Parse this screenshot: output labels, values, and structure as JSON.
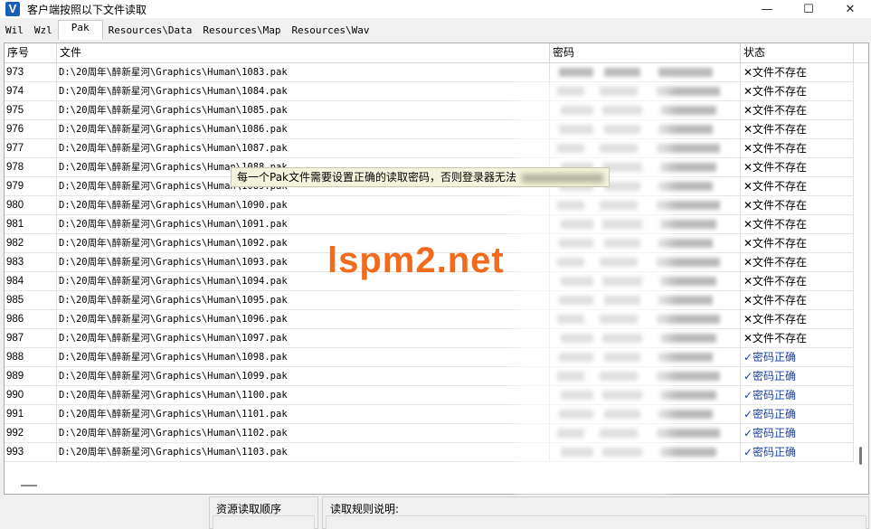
{
  "window": {
    "icon_letter": "V",
    "title": "客户端按照以下文件读取",
    "minimize": "—",
    "maximize": "☐",
    "close": "✕"
  },
  "tabs": [
    "Wil",
    "Wzl",
    "Pak",
    "Resources\\Data",
    "Resources\\Map",
    "Resources\\Wav"
  ],
  "active_tab": "Pak",
  "table": {
    "headers": {
      "index": "序号",
      "file": "文件",
      "password": "密码",
      "status": "状态"
    },
    "rows": [
      {
        "index": "973",
        "file": "D:\\20周年\\醉新星河\\Graphics\\Human\\1083.pak",
        "status": "✕文件不存在",
        "ok": false
      },
      {
        "index": "974",
        "file": "D:\\20周年\\醉新星河\\Graphics\\Human\\1084.pak",
        "status": "✕文件不存在",
        "ok": false
      },
      {
        "index": "975",
        "file": "D:\\20周年\\醉新星河\\Graphics\\Human\\1085.pak",
        "status": "✕文件不存在",
        "ok": false
      },
      {
        "index": "976",
        "file": "D:\\20周年\\醉新星河\\Graphics\\Human\\1086.pak",
        "status": "✕文件不存在",
        "ok": false
      },
      {
        "index": "977",
        "file": "D:\\20周年\\醉新星河\\Graphics\\Human\\1087.pak",
        "status": "✕文件不存在",
        "ok": false
      },
      {
        "index": "978",
        "file": "D:\\20周年\\醉新星河\\Graphics\\Human\\1088.pak",
        "status": "✕文件不存在",
        "ok": false
      },
      {
        "index": "979",
        "file": "D:\\20周年\\醉新星河\\Graphics\\Human\\1089.pak",
        "status": "✕文件不存在",
        "ok": false
      },
      {
        "index": "980",
        "file": "D:\\20周年\\醉新星河\\Graphics\\Human\\1090.pak",
        "status": "✕文件不存在",
        "ok": false
      },
      {
        "index": "981",
        "file": "D:\\20周年\\醉新星河\\Graphics\\Human\\1091.pak",
        "status": "✕文件不存在",
        "ok": false
      },
      {
        "index": "982",
        "file": "D:\\20周年\\醉新星河\\Graphics\\Human\\1092.pak",
        "status": "✕文件不存在",
        "ok": false
      },
      {
        "index": "983",
        "file": "D:\\20周年\\醉新星河\\Graphics\\Human\\1093.pak",
        "status": "✕文件不存在",
        "ok": false
      },
      {
        "index": "984",
        "file": "D:\\20周年\\醉新星河\\Graphics\\Human\\1094.pak",
        "status": "✕文件不存在",
        "ok": false
      },
      {
        "index": "985",
        "file": "D:\\20周年\\醉新星河\\Graphics\\Human\\1095.pak",
        "status": "✕文件不存在",
        "ok": false
      },
      {
        "index": "986",
        "file": "D:\\20周年\\醉新星河\\Graphics\\Human\\1096.pak",
        "status": "✕文件不存在",
        "ok": false
      },
      {
        "index": "987",
        "file": "D:\\20周年\\醉新星河\\Graphics\\Human\\1097.pak",
        "status": "✕文件不存在",
        "ok": false
      },
      {
        "index": "988",
        "file": "D:\\20周年\\醉新星河\\Graphics\\Human\\1098.pak",
        "status": "✓密码正确",
        "ok": true
      },
      {
        "index": "989",
        "file": "D:\\20周年\\醉新星河\\Graphics\\Human\\1099.pak",
        "status": "✓密码正确",
        "ok": true
      },
      {
        "index": "990",
        "file": "D:\\20周年\\醉新星河\\Graphics\\Human\\1100.pak",
        "status": "✓密码正确",
        "ok": true
      },
      {
        "index": "991",
        "file": "D:\\20周年\\醉新星河\\Graphics\\Human\\1101.pak",
        "status": "✓密码正确",
        "ok": true
      },
      {
        "index": "992",
        "file": "D:\\20周年\\醉新星河\\Graphics\\Human\\1102.pak",
        "status": "✓密码正确",
        "ok": true
      },
      {
        "index": "993",
        "file": "D:\\20周年\\醉新星河\\Graphics\\Human\\1103.pak",
        "status": "✓密码正确",
        "ok": true
      }
    ]
  },
  "tooltip": {
    "text": "每一个Pak文件需要设置正确的读取密码，否则登录器无法"
  },
  "watermark": "lspm2.net",
  "bottom": {
    "order_label": "资源读取顺序",
    "rules_label": "读取规则说明:"
  },
  "colors": {
    "ok_status": "#1a3fa0",
    "watermark": "#f26a1b"
  }
}
